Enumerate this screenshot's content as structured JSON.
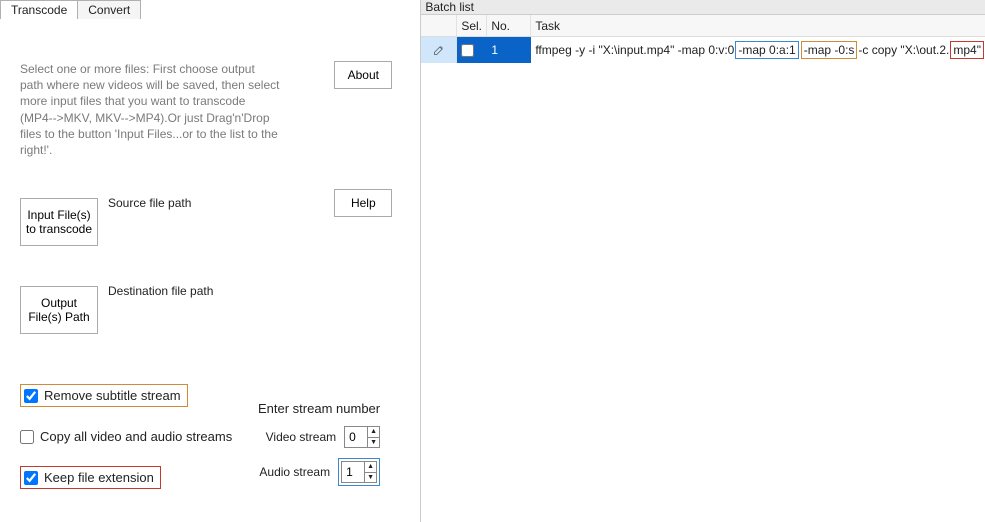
{
  "tabs": {
    "transcode": "Transcode",
    "convert": "Convert"
  },
  "intro": "Select one or more files: First choose output path where new videos will be saved, then select more input files that you want to transcode (MP4-->MKV, MKV-->MP4).Or just Drag'n'Drop files to the button 'Input Files...or to the list to the right!'.",
  "buttons": {
    "about": "About",
    "help": "Help",
    "input": "Input File(s) to transcode",
    "output": "Output File(s) Path"
  },
  "labels": {
    "source": "Source file path",
    "dest": "Destination file path"
  },
  "checks": {
    "removeSub": {
      "label": "Remove subtitle stream",
      "checked": true
    },
    "copyAll": {
      "label": "Copy all video and audio streams",
      "checked": false
    },
    "keepExt": {
      "label": "Keep file extension",
      "checked": true
    }
  },
  "streams": {
    "title": "Enter stream number",
    "video": {
      "label": "Video stream",
      "value": "0"
    },
    "audio": {
      "label": "Audio stream",
      "value": "1"
    }
  },
  "batch": {
    "title": "Batch list",
    "headers": {
      "sel": "Sel.",
      "no": "No.",
      "task": "Task"
    },
    "row": {
      "no": "1",
      "task_parts": {
        "p1": "ffmpeg -y -i \"X:\\input.mp4\"  -map 0:v:0",
        "p2": "-map 0:a:1",
        "p3": "-map -0:s",
        "p4": "-c copy \"X:\\out.2.",
        "p5": "mp4\""
      }
    }
  }
}
